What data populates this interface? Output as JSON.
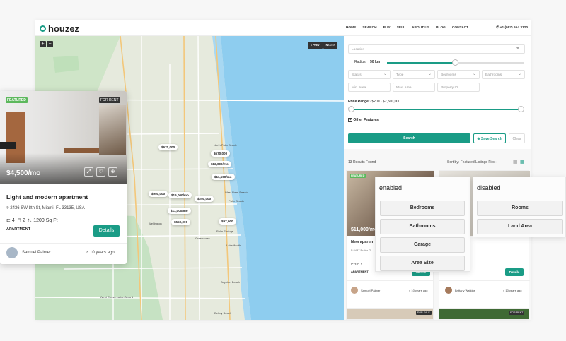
{
  "header": {
    "logo_text": "houzez",
    "nav": [
      "HOME",
      "SEARCH",
      "BUY",
      "SELL",
      "ABOUT US",
      "BLOG",
      "CONTACT"
    ],
    "phone": "+1 (987) 654 3120"
  },
  "map": {
    "zoom_in": "+",
    "zoom_out": "−",
    "prev": "< PREV",
    "next": "NEXT >",
    "pins": [
      "$670,000",
      "$670,000",
      "$12,000/mo",
      "$11,500/mo",
      "$950,000",
      "$16,000/mo",
      "$250,000",
      "$11,000/mo",
      "$550,000",
      "$97,000"
    ],
    "labels": [
      "North Palm Beach",
      "West Palm Beach",
      "Palm Beach",
      "Wellington",
      "Palm Springs",
      "Greenacres",
      "Lake Worth",
      "Boynton Beach",
      "Delray Beach",
      "West Conservation Area 1"
    ]
  },
  "search": {
    "location_placeholder": "Location",
    "radius_label": "Radius:",
    "radius_value": "50 km",
    "status": "Status",
    "type": "Type",
    "bedrooms": "Bedrooms",
    "bathrooms": "Bathrooms",
    "min_area": "Min. Area",
    "max_area": "Max. Area",
    "property_id": "Property ID",
    "price_range_label": "Price Range",
    "price_min": "$200",
    "price_max": "$2,500,000",
    "other_features": "Other Features",
    "search_button": "Search",
    "save_search_button": "Save Search",
    "clear_button": "Clear"
  },
  "results": {
    "count": "13 Results Found",
    "sort_label": "Sort by:",
    "sort_value": "Featured Listings First",
    "cards": [
      {
        "badge": "FEATURED",
        "price": "$11,000/mo",
        "title": "New apartm",
        "address": "8437 Butler Gl",
        "beds": "3",
        "baths": "1",
        "type": "APARTMENT",
        "agent": "Samuel Palmer",
        "date": "10 years ago",
        "details": "Details"
      },
      {
        "agent": "Brittany Watkins",
        "date": "10 years ago",
        "details": "Details"
      },
      {
        "badge_rent": "FOR SALE"
      },
      {
        "badge_rent": "FOR RENT"
      }
    ]
  },
  "featured": {
    "badge": "FEATURED",
    "status": "FOR RENT",
    "price": "$4,500/mo",
    "title": "Light and modern apartment",
    "address": "2436 SW 8th St, Miami, FL 33135, USA",
    "beds": "4",
    "baths": "2",
    "area": "1200 Sq Ft",
    "type": "APARTMENT",
    "details": "Details",
    "agent": "Samuel Palmer",
    "date": "10 years ago"
  },
  "popup": {
    "enabled_title": "enabled",
    "disabled_title": "disabled",
    "enabled_items": [
      "Bedrooms",
      "Bathrooms",
      "Garage",
      "Area Size"
    ],
    "disabled_items": [
      "Rooms",
      "Land Area"
    ]
  },
  "colors": {
    "accent": "#1a9c86",
    "featured": "#5cb85c",
    "water": "#8ecdef"
  }
}
